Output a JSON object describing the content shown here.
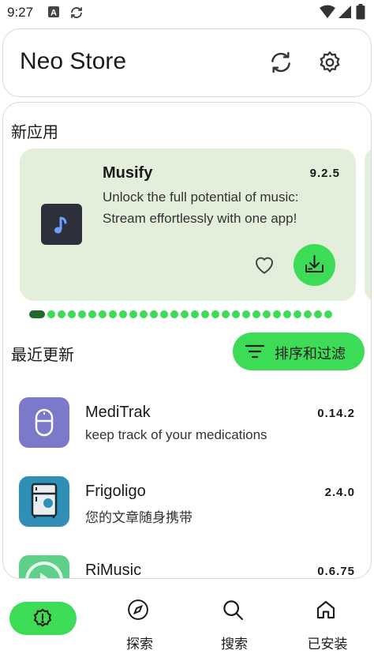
{
  "status_bar": {
    "time": "9:27",
    "icons": [
      "a-letter-icon",
      "sync-icon",
      "wifi-icon",
      "signal-icon",
      "battery-icon"
    ]
  },
  "header": {
    "title": "Neo Store",
    "sync_icon": "sync-icon",
    "settings_icon": "settings-icon"
  },
  "new_apps": {
    "section_title": "新应用",
    "featured": {
      "name": "Musify",
      "version": "9.2.5",
      "description": "Unlock the full potential of music: Stream effortlessly with one app!",
      "favorite_icon": "heart-icon",
      "download_icon": "download-icon"
    },
    "carousel": {
      "total": 29,
      "active_index": 0
    }
  },
  "recent_updates": {
    "section_title": "最近更新",
    "sort_button_label": "排序和过滤",
    "apps": [
      {
        "name": "MediTrak",
        "version": "0.14.2",
        "description": "keep track of your medications"
      },
      {
        "name": "Frigoligo",
        "version": "2.4.0",
        "description": "您的文章随身携带"
      },
      {
        "name": "RiMusic",
        "version": "0.6.75",
        "description": ""
      }
    ]
  },
  "bottom_nav": {
    "items": [
      {
        "label": "",
        "icon": "alert-badge-icon",
        "active": true
      },
      {
        "label": "探索",
        "icon": "compass-icon",
        "active": false
      },
      {
        "label": "搜索",
        "icon": "search-icon",
        "active": false
      },
      {
        "label": "已安装",
        "icon": "home-icon",
        "active": false
      }
    ]
  },
  "colors": {
    "accent": "#3DDC57",
    "accent_dark": "#1F6B2C",
    "card_bg": "#E3EEDB",
    "meditrak": "#7B79C9",
    "frigoligo": "#2F8FB7",
    "rimusic": "#5DD08A"
  }
}
